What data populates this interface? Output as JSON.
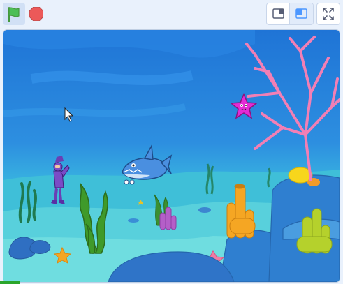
{
  "toolbar": {
    "green_flag_icon": "green-flag-icon",
    "stop_icon": "stop-sign-icon",
    "small_stage_icon": "small-stage-layout-icon",
    "normal_stage_icon": "normal-stage-layout-icon",
    "fullscreen_icon": "fullscreen-icon"
  },
  "colors": {
    "flag_green": "#4cbf56",
    "stop_red": "#ec5959",
    "accent_blue": "#4c97ff",
    "toolbar_bg": "#e9f1fc",
    "progress_green": "#2ba52b"
  },
  "stage": {
    "backdrop": "underwater",
    "sprites": [
      "diver",
      "shark",
      "starfish",
      "coral",
      "seaweed",
      "sponge",
      "rocks"
    ]
  },
  "loading": {
    "progress_fraction": 0.06
  }
}
